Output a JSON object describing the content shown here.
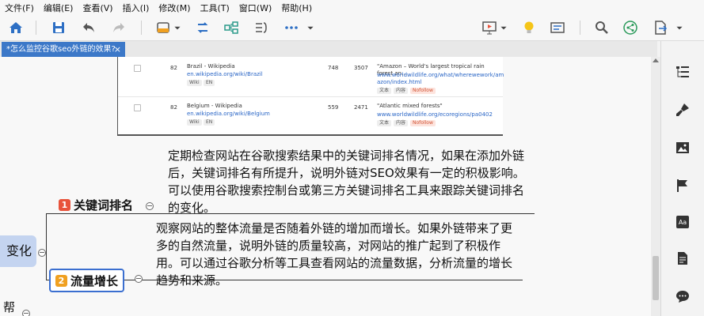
{
  "menubar": {
    "items": [
      "文件(F)",
      "编辑(E)",
      "查看(V)",
      "插入(I)",
      "修改(M)",
      "工具(T)",
      "窗口(W)",
      "帮助(H)"
    ]
  },
  "toolbar": {
    "icons": [
      "home-icon",
      "save-icon",
      "undo-icon",
      "redo-icon",
      "topic-style-icon",
      "relationship-icon",
      "subtopic-icon",
      "summary-icon",
      "more-icon",
      "presentation-icon",
      "idea-icon",
      "outline-icon",
      "search-icon",
      "share-icon",
      "export-icon"
    ]
  },
  "tab": {
    "title": "*怎么监控谷歌seo外链的效果?",
    "close": "×"
  },
  "embedded_table": {
    "rows": [
      {
        "num": "82",
        "title": "Brazil - Wikipedia",
        "url": "en.wikipedia.org/wiki/Brazil",
        "tags": [
          "Wiki",
          "EN"
        ],
        "col1": "748",
        "col2": "3507",
        "anchor": "\"Amazon – World's largest tropical rain forest an...",
        "anchor_url": "www.worldwildlife.org/what/wherewework/am azon/index.html",
        "anchor_tags": [
          "文本",
          "内容",
          "Nofollow"
        ]
      },
      {
        "num": "82",
        "title": "Belgium - Wikipedia",
        "url": "en.wikipedia.org/wiki/Belgium",
        "tags": [
          "Wiki",
          "EN"
        ],
        "col1": "559",
        "col2": "2471",
        "anchor": "\"Atlantic mixed forests\"",
        "anchor_url": "www.worldwildlife.org/ecoregions/pa0402",
        "anchor_tags": [
          "文本",
          "内容",
          "Nofollow"
        ]
      }
    ]
  },
  "mindmap": {
    "parent_label": "变化",
    "partial_bottom_label": "帮",
    "topics": [
      {
        "badge": "1",
        "badge_color": "#e8533b",
        "label": "关键词排名",
        "text": "定期检查网站在谷歌搜索结果中的关键词排名情况，如果在添加外链后，关键词排名有所提升，说明外链对SEO效果有一定的积极影响。可以使用谷歌搜索控制台或第三方关键词排名工具来跟踪关键词排名的变化。"
      },
      {
        "badge": "2",
        "badge_color": "#f0a020",
        "label": "流量增长",
        "text": "观察网站的整体流量是否随着外链的增加而增长。如果外链带来了更多的自然流量，说明外链的质量较高，对网站的推广起到了积极作用。可以通过谷歌分析等工具查看网站的流量数据，分析流量的增长趋势和来源。"
      }
    ]
  },
  "right_panel": {
    "icons": [
      "outline-panel-icon",
      "format-brush-icon",
      "image-icon",
      "flag-icon",
      "text-style-icon",
      "notes-icon",
      "comment-icon"
    ]
  }
}
